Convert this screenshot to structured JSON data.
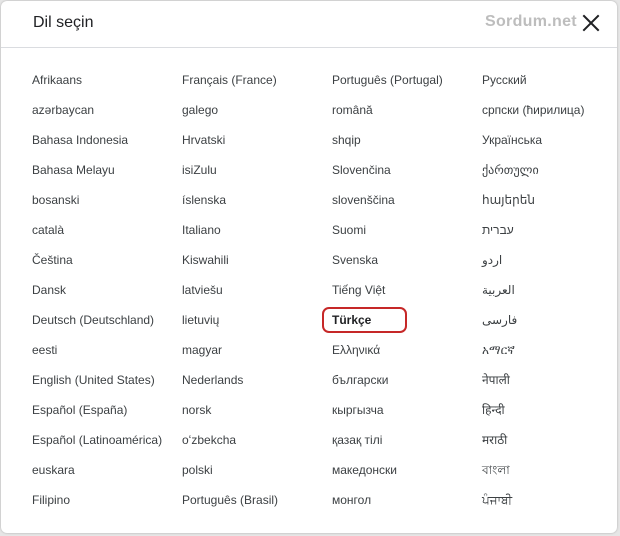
{
  "dialog": {
    "title": "Dil seçin",
    "watermark": "Sordum.net",
    "accent_color": "#c62828"
  },
  "columns": [
    [
      "Afrikaans",
      "azərbaycan",
      "Bahasa Indonesia",
      "Bahasa Melayu",
      "bosanski",
      "català",
      "Čeština",
      "Dansk",
      "Deutsch (Deutschland)",
      "eesti",
      "English (United States)",
      "Español (España)",
      "Español (Latinoamérica)",
      "euskara",
      "Filipino"
    ],
    [
      "Français (France)",
      "galego",
      "Hrvatski",
      "isiZulu",
      "íslenska",
      "Italiano",
      "Kiswahili",
      "latviešu",
      "lietuvių",
      "magyar",
      "Nederlands",
      "norsk",
      "oʻzbekcha",
      "polski",
      "Português (Brasil)"
    ],
    [
      "Português (Portugal)",
      "română",
      "shqip",
      "Slovenčina",
      "slovenščina",
      "Suomi",
      "Svenska",
      "Tiếng Việt",
      "Türkçe",
      "Ελληνικά",
      "български",
      "кыргызча",
      "қазақ тілі",
      "македонски",
      "монгол"
    ],
    [
      "Русский",
      "српски (ћирилица)",
      "Українська",
      "ქართული",
      "հայերեն",
      "עברית",
      "اردو",
      "العربية",
      "فارسی",
      "አማርኛ",
      "नेपाली",
      "हिन्दी",
      "मराठी",
      "বাংলা",
      "ਪੰਜਾਬੀ"
    ]
  ],
  "selected_language": "Türkçe"
}
